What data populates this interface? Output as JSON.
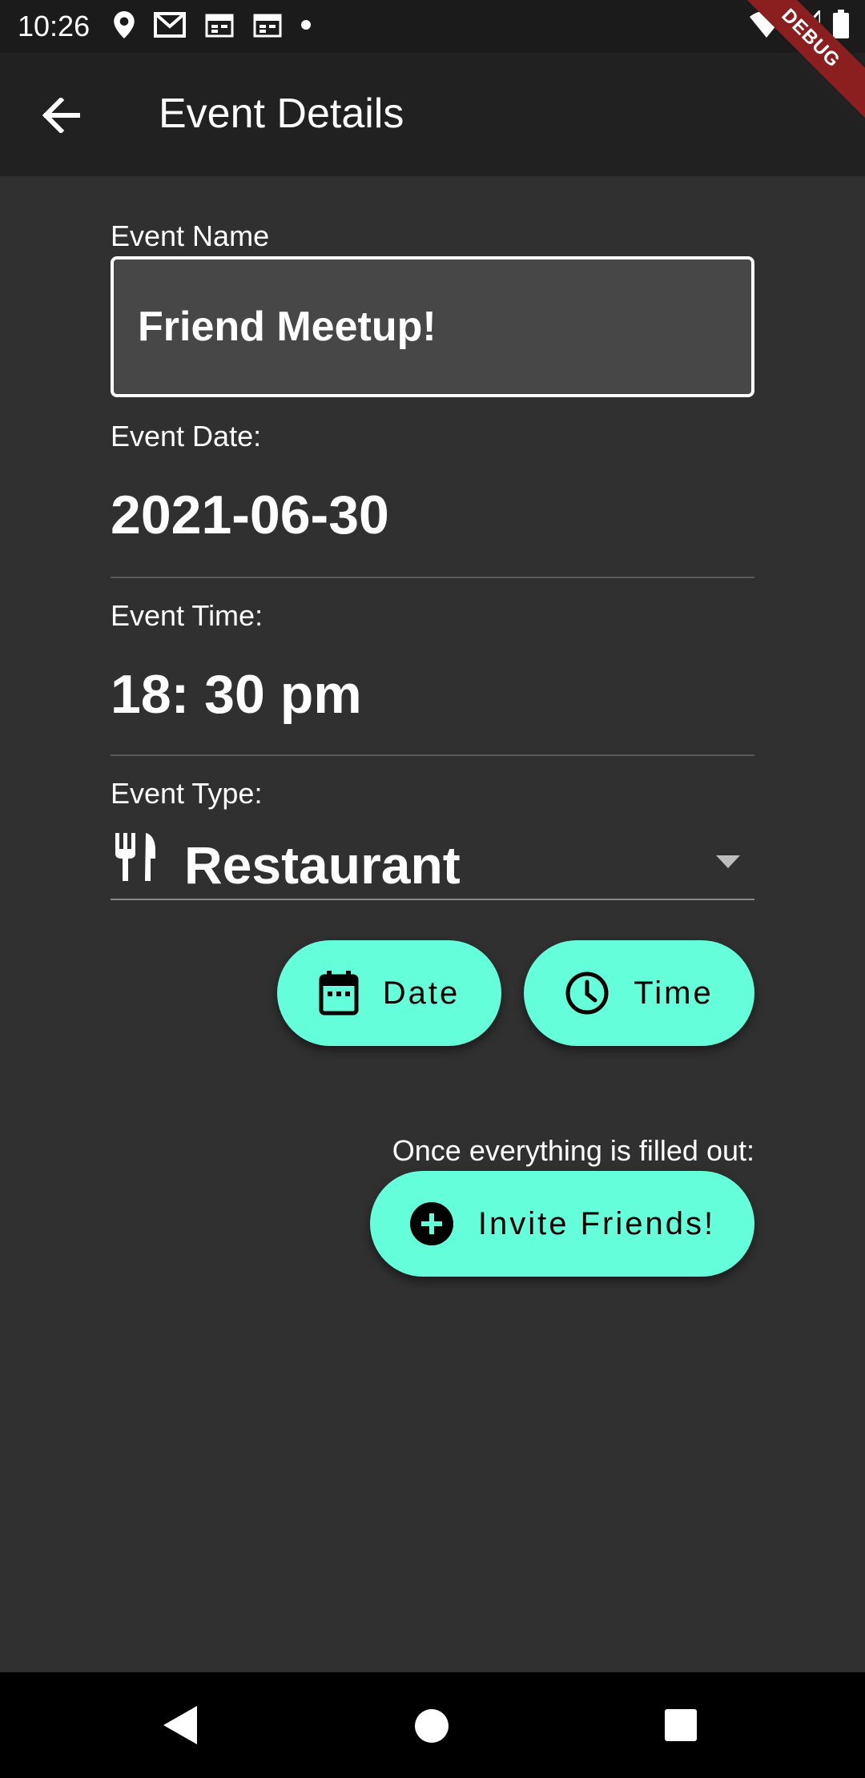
{
  "status_bar": {
    "time": "10:26",
    "left_icons": [
      "location-pin-icon",
      "gmail-icon",
      "calendar-notification-icon",
      "calendar-notification-icon",
      "dot-icon"
    ],
    "right_icons": [
      "wifi-icon",
      "signal-icon",
      "battery-icon"
    ]
  },
  "debug_banner": "DEBUG",
  "app_bar": {
    "title": "Event Details",
    "back_icon": "arrow-back-icon"
  },
  "form": {
    "event_name": {
      "label": "Event Name",
      "value": "Friend Meetup!"
    },
    "event_date": {
      "label": "Event Date:",
      "value": "2021-06-30"
    },
    "event_time": {
      "label": "Event Time:",
      "value": "18: 30 pm"
    },
    "event_type": {
      "label": "Event Type:",
      "value": "Restaurant",
      "icon": "restaurant-icon"
    }
  },
  "buttons": {
    "date": {
      "label": "Date",
      "icon": "calendar-icon"
    },
    "time": {
      "label": "Time",
      "icon": "clock-icon"
    },
    "invite": {
      "label": "Invite Friends!",
      "icon": "add-circle-icon"
    }
  },
  "invite_hint": "Once everything is filled out:",
  "colors": {
    "accent": "#64ffda",
    "background": "#303030",
    "app_bar": "#212121",
    "status_bar": "#1b1b1b",
    "debug_banner": "#8b1f1f"
  }
}
